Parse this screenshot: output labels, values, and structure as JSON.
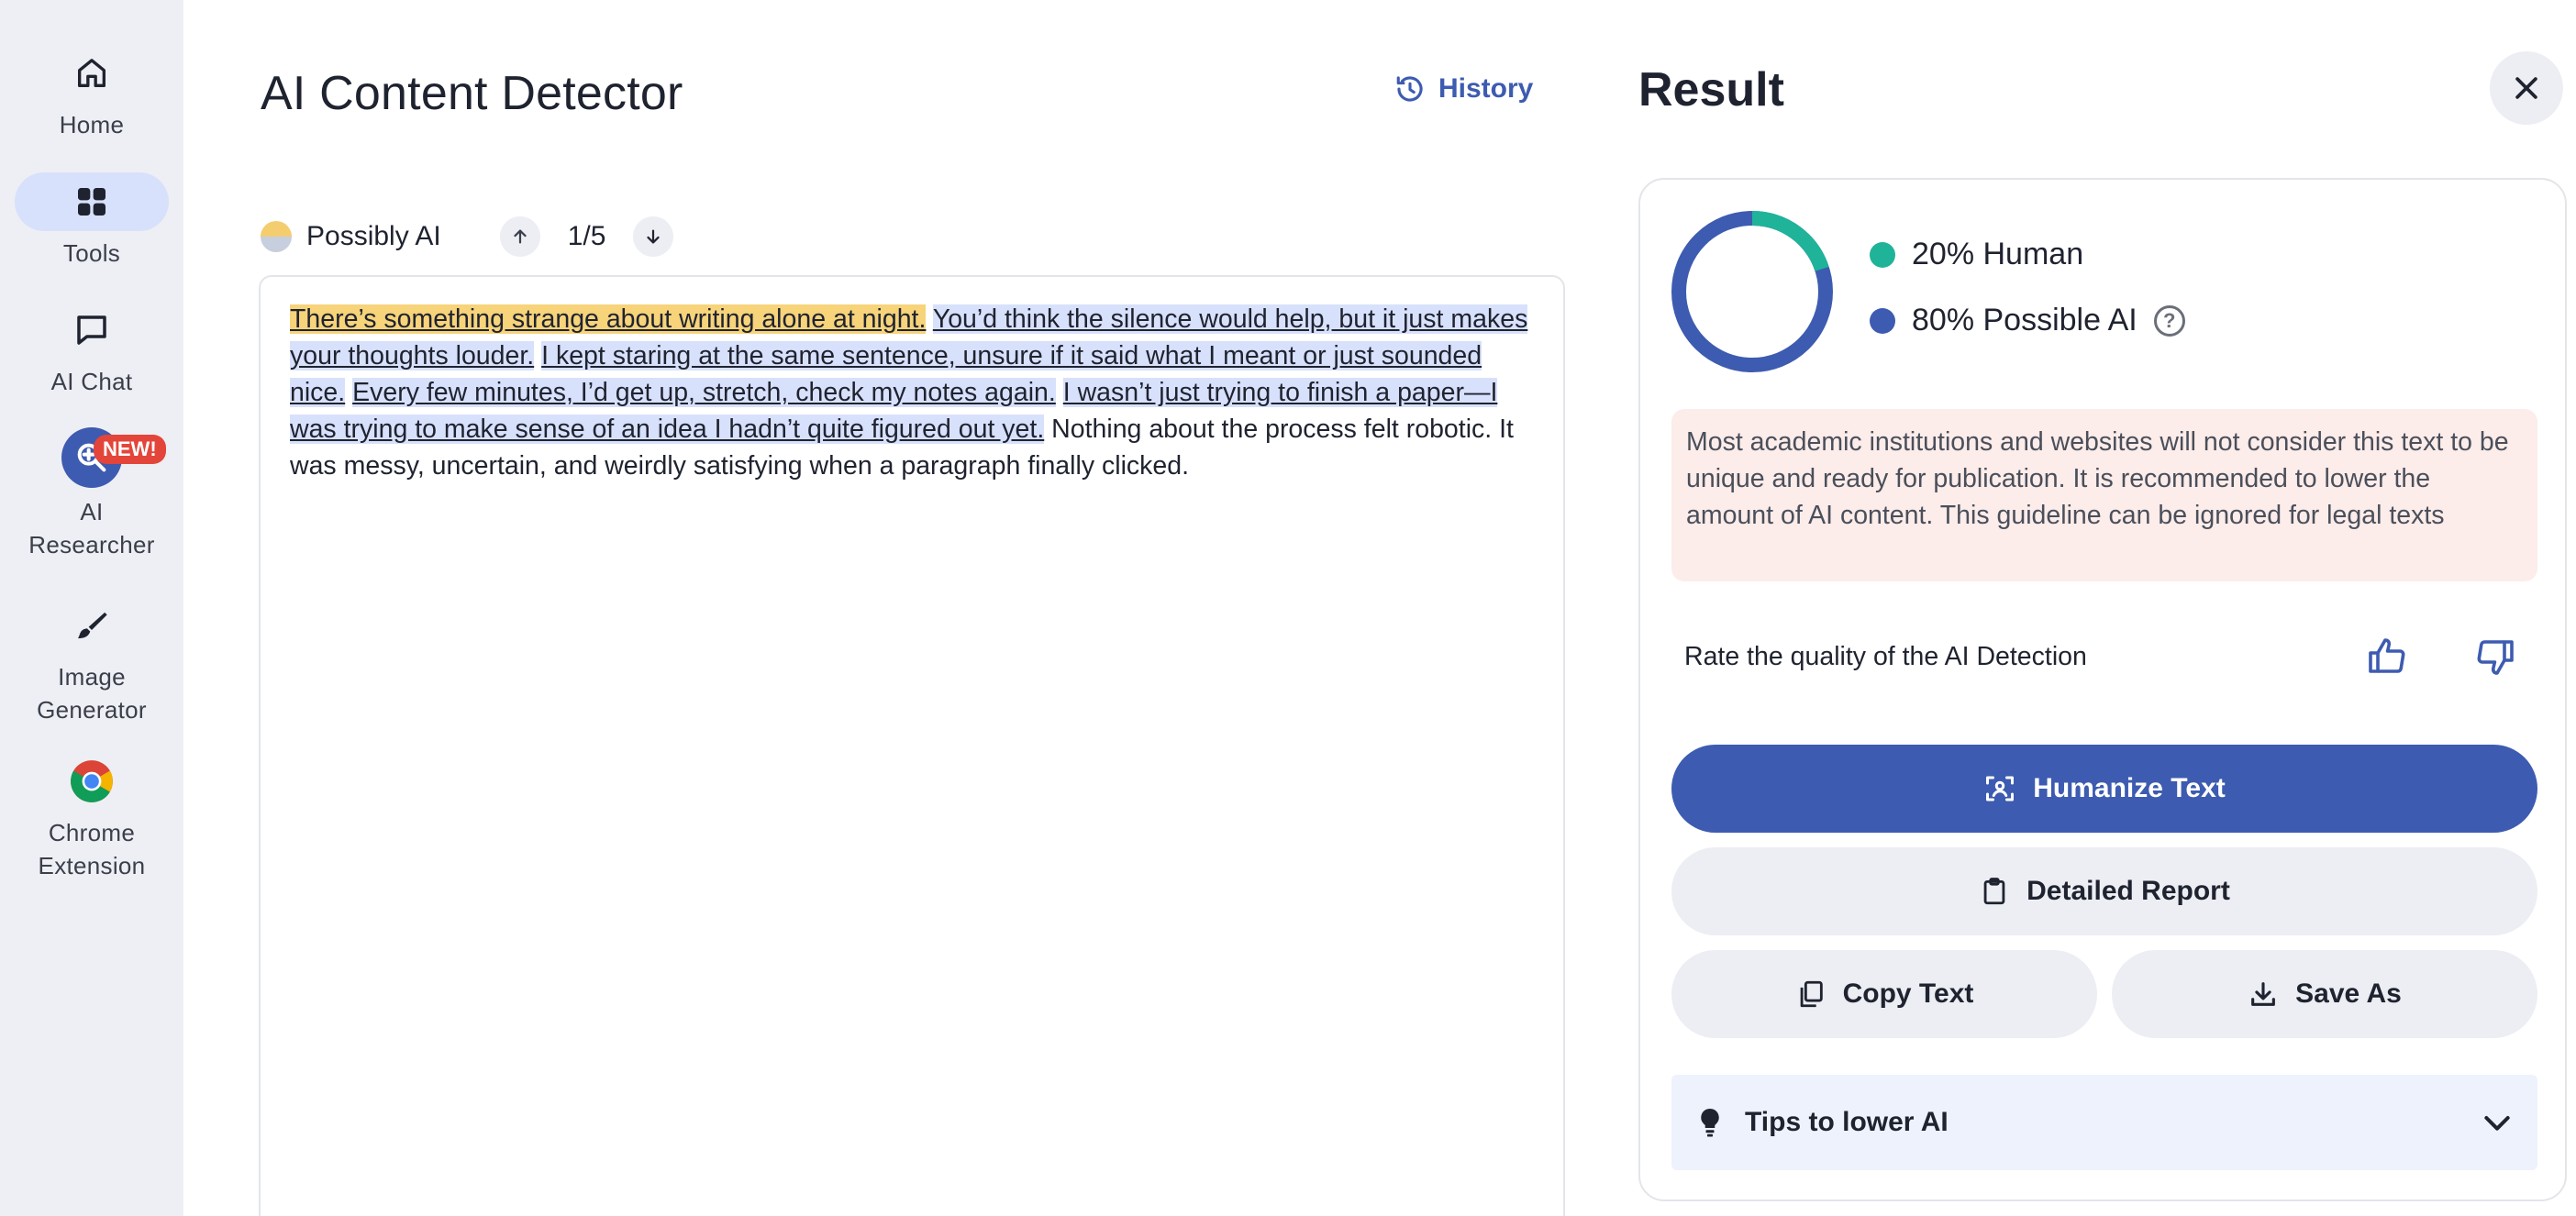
{
  "sidebar": {
    "items": [
      {
        "label": "Home",
        "icon": "home-icon"
      },
      {
        "label": "Tools",
        "icon": "grid-icon",
        "active": true
      },
      {
        "label": "AI Chat",
        "icon": "chat-icon"
      },
      {
        "label": "AI\nResearcher",
        "icon": "search-plus-icon",
        "badge": "NEW!"
      },
      {
        "label": "Image\nGenerator",
        "icon": "brush-icon"
      },
      {
        "label": "Chrome\nExtension",
        "icon": "chrome-icon"
      }
    ]
  },
  "main": {
    "title": "AI Content Detector",
    "history_label": "History",
    "status_label": "Possibly AI",
    "counter": "1/5",
    "segments": [
      {
        "text": "There’s something strange about writing alone at night.",
        "highlight": "yellow"
      },
      {
        "text": " "
      },
      {
        "text": "You’d think the silence would help, but it just makes your thoughts louder.",
        "highlight": "blue"
      },
      {
        "text": " "
      },
      {
        "text": "I kept staring at the same sentence, unsure if it said what I meant or just sounded nice.",
        "highlight": "blue"
      },
      {
        "text": " "
      },
      {
        "text": "Every few minutes, I’d get up, stretch, check my notes again.",
        "highlight": "blue"
      },
      {
        "text": " "
      },
      {
        "text": "I wasn’t just trying to finish a paper—I was trying to make sense of an idea I hadn’t quite figured out yet.",
        "highlight": "blue"
      },
      {
        "text": " Nothing about the process felt robotic. It was messy, uncertain, and weirdly satisfying when a paragraph finally clicked."
      }
    ]
  },
  "result": {
    "title": "Result",
    "human_pct": 20,
    "ai_pct": 80,
    "human_label": "20% Human",
    "ai_label": "80% Possible AI",
    "help_glyph": "?",
    "warning": "Most academic institutions and websites will not consider this text to be unique and ready for publication. It is recommended to lower the amount of AI content. This guideline can be ignored for legal texts",
    "rate_label": "Rate the quality of the AI Detection",
    "humanize_label": "Humanize Text",
    "report_label": "Detailed Report",
    "copy_label": "Copy Text",
    "save_label": "Save As",
    "tips_label": "Tips to lower AI"
  },
  "colors": {
    "accent": "#3d5bb0",
    "human": "#1fb39a",
    "ai": "#3d5bb0",
    "highlight_yellow": "#f7d37a",
    "highlight_blue": "#d8e1fb",
    "warning_bg": "#fcecea"
  }
}
